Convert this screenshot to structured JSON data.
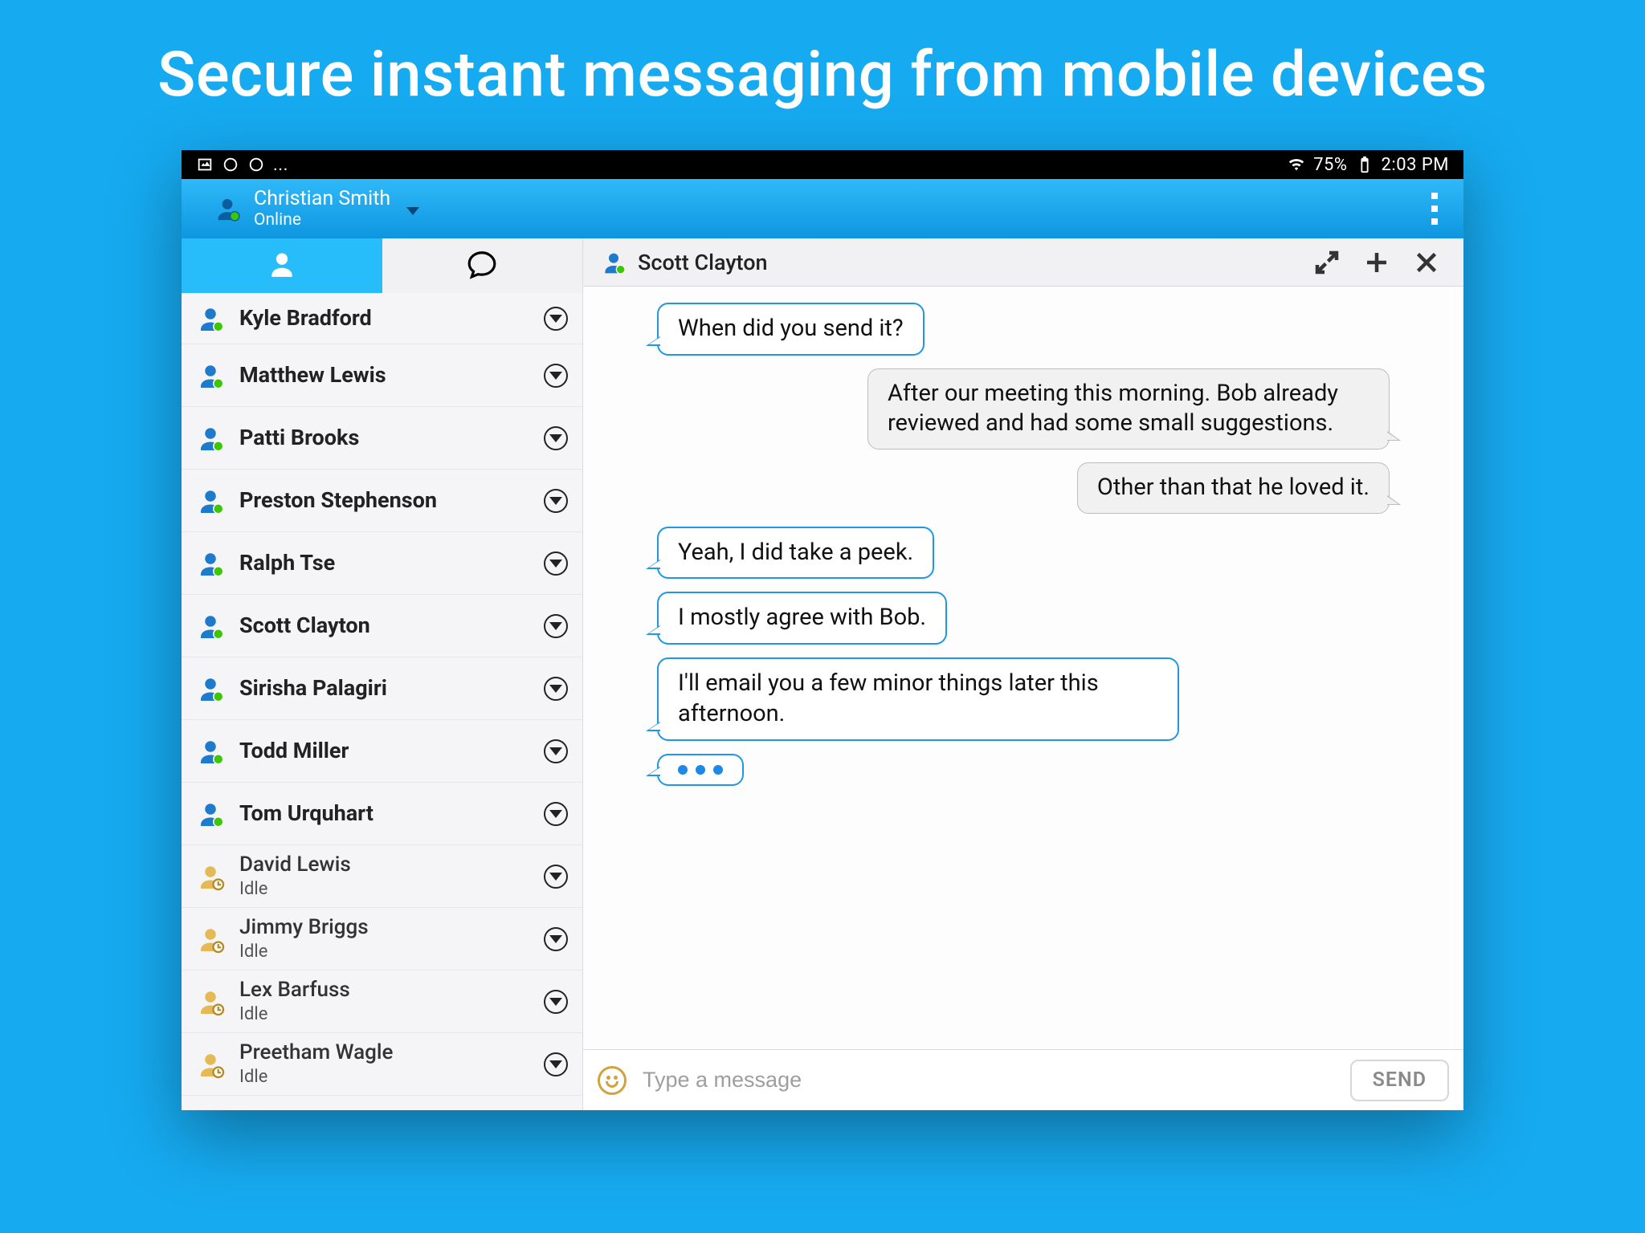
{
  "hero": {
    "title": "Secure instant messaging from mobile devices"
  },
  "statusbar": {
    "battery_pct": "75%",
    "time": "2:03 PM",
    "more": "..."
  },
  "header": {
    "user_name": "Christian Smith",
    "user_status": "Online"
  },
  "sidebar": {
    "contacts": [
      {
        "name": "Kyle Bradford",
        "sub": "",
        "presence": "online"
      },
      {
        "name": "Matthew Lewis",
        "sub": "",
        "presence": "online"
      },
      {
        "name": "Patti Brooks",
        "sub": "",
        "presence": "online"
      },
      {
        "name": "Preston Stephenson",
        "sub": "",
        "presence": "online"
      },
      {
        "name": "Ralph Tse",
        "sub": "",
        "presence": "online"
      },
      {
        "name": "Scott Clayton",
        "sub": "",
        "presence": "online"
      },
      {
        "name": "Sirisha Palagiri",
        "sub": "",
        "presence": "online"
      },
      {
        "name": "Todd Miller",
        "sub": "",
        "presence": "online"
      },
      {
        "name": "Tom Urquhart",
        "sub": "",
        "presence": "online"
      },
      {
        "name": "David Lewis",
        "sub": "Idle",
        "presence": "idle"
      },
      {
        "name": "Jimmy Briggs",
        "sub": "Idle",
        "presence": "idle"
      },
      {
        "name": "Lex Barfuss",
        "sub": "Idle",
        "presence": "idle"
      },
      {
        "name": "Preetham Wagle",
        "sub": "Idle",
        "presence": "idle"
      }
    ]
  },
  "chat": {
    "title": "Scott Clayton",
    "messages": [
      {
        "dir": "in",
        "text": "When did you send it?"
      },
      {
        "dir": "out",
        "text": "After our meeting this morning. Bob already reviewed and had some small suggestions."
      },
      {
        "dir": "out",
        "text": "Other than that he loved it."
      },
      {
        "dir": "in",
        "text": "Yeah, I did take a peek."
      },
      {
        "dir": "in",
        "text": "I mostly agree with Bob."
      },
      {
        "dir": "in",
        "text": "I'll email you a few minor things later this afternoon."
      }
    ]
  },
  "composer": {
    "placeholder": "Type a message",
    "send_label": "SEND"
  }
}
